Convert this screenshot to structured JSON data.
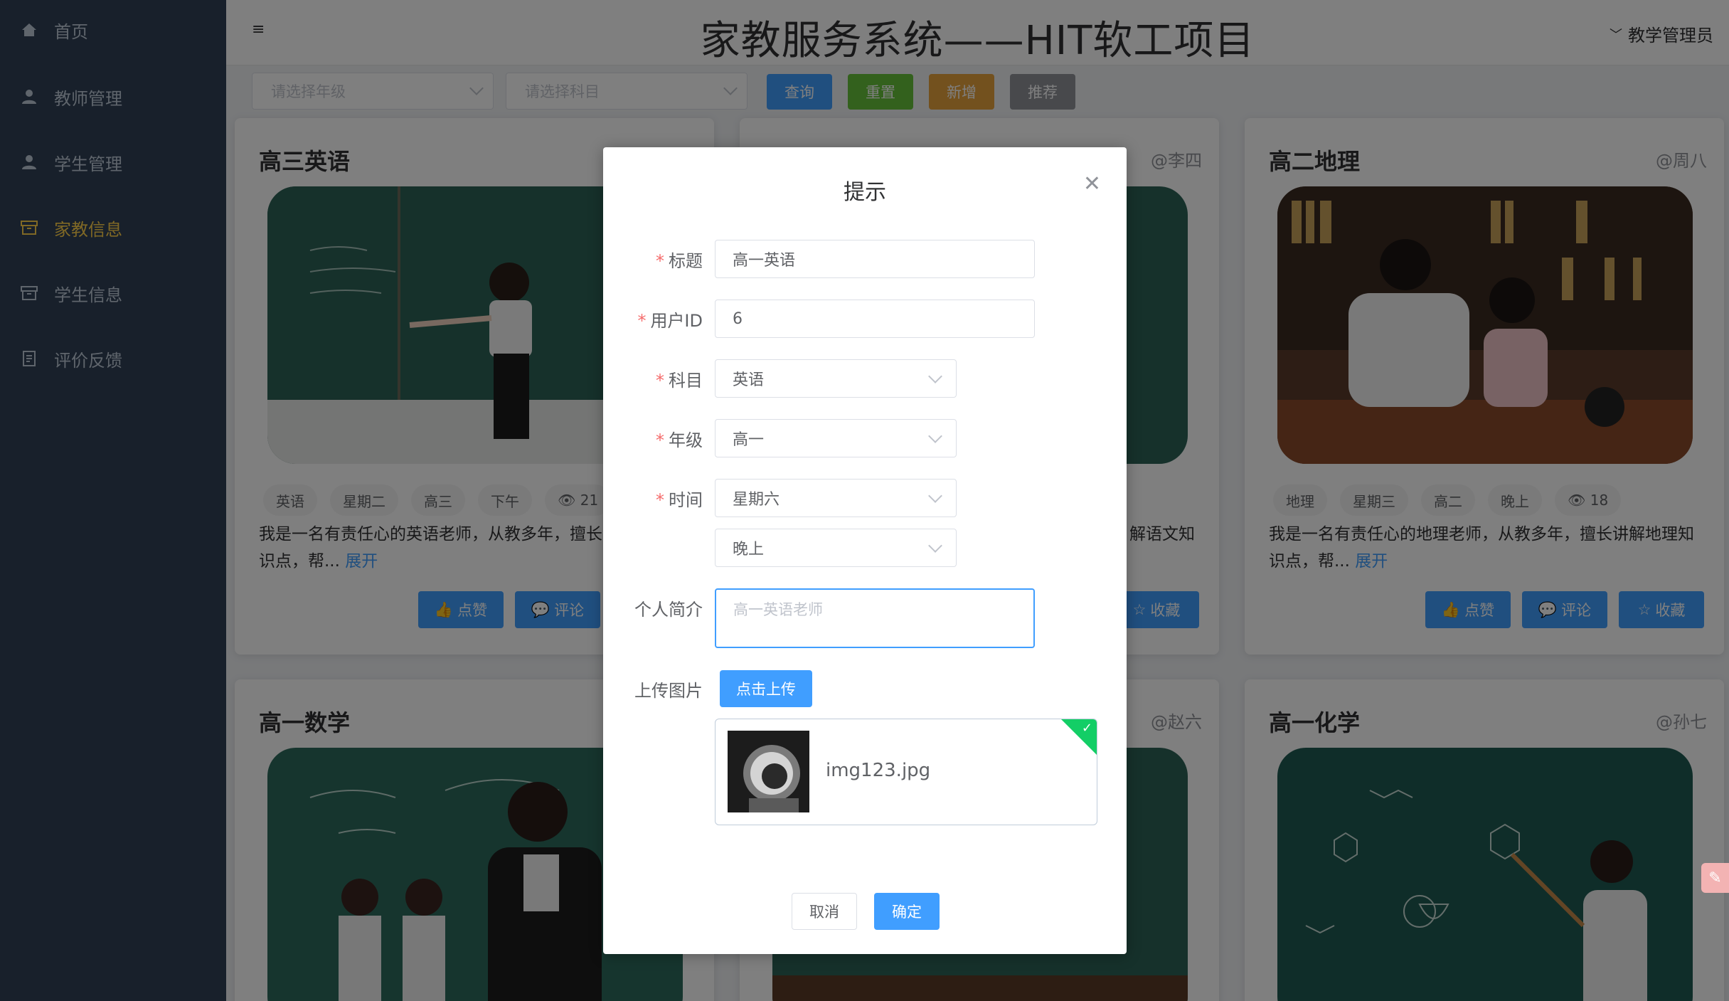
{
  "sidebar": {
    "items": [
      {
        "label": "首页",
        "icon": "home-icon"
      },
      {
        "label": "教师管理",
        "icon": "user-icon"
      },
      {
        "label": "学生管理",
        "icon": "user-icon"
      },
      {
        "label": "家教信息",
        "icon": "box-icon",
        "active": true
      },
      {
        "label": "学生信息",
        "icon": "box-icon"
      },
      {
        "label": "评价反馈",
        "icon": "document-icon"
      }
    ]
  },
  "header": {
    "title": "家教服务系统——HIT软工项目",
    "user": "教学管理员"
  },
  "toolbar": {
    "grade_placeholder": "请选择年级",
    "subject_placeholder": "请选择科目",
    "query": "查询",
    "reset": "重置",
    "add": "新增",
    "recommend": "推荐"
  },
  "cards": [
    {
      "title": "高三英语",
      "author": "",
      "tags": [
        "英语",
        "星期二",
        "高三",
        "下午"
      ],
      "views": "21",
      "desc": "我是一名有责任心的英语老师，从教多年，擅长",
      "desc2": "识点，帮...",
      "more": "展开",
      "like": "点赞",
      "comment": "评论",
      "collect": ""
    },
    {
      "title": "",
      "author": "@李四",
      "tags": [],
      "views": "",
      "desc": "解语文知",
      "desc2": "",
      "more": "",
      "like": "",
      "comment": "",
      "collect": "收藏"
    },
    {
      "title": "高二地理",
      "author": "@周八",
      "tags": [
        "地理",
        "星期三",
        "高二",
        "晚上"
      ],
      "views": "18",
      "desc": "我是一名有责任心的地理老师，从教多年，擅长讲解地理知",
      "desc2": "识点，帮...",
      "more": "展开",
      "like": "点赞",
      "comment": "评论",
      "collect": "收藏"
    },
    {
      "title": "高一数学",
      "author": ""
    },
    {
      "title": "",
      "author": "@赵六"
    },
    {
      "title": "高一化学",
      "author": "@孙七"
    }
  ],
  "dialog": {
    "title": "提示",
    "fields": {
      "title_label": "标题",
      "title_value": "高一英语",
      "userid_label": "用户ID",
      "userid_value": "6",
      "subject_label": "科目",
      "subject_value": "英语",
      "grade_label": "年级",
      "grade_value": "高一",
      "time_label": "时间",
      "time_day": "星期六",
      "time_slot": "晚上",
      "intro_label": "个人简介",
      "intro_value": "高一英语老师",
      "upload_label": "上传图片",
      "upload_button": "点击上传",
      "upload_file": "img123.jpg"
    },
    "cancel": "取消",
    "confirm": "确定"
  },
  "colors": {
    "sidebar_bg": "#304156",
    "active": "#ffd04b",
    "primary": "#409eff",
    "success": "#67c23a",
    "warning": "#e6a23c",
    "info": "#909399"
  }
}
